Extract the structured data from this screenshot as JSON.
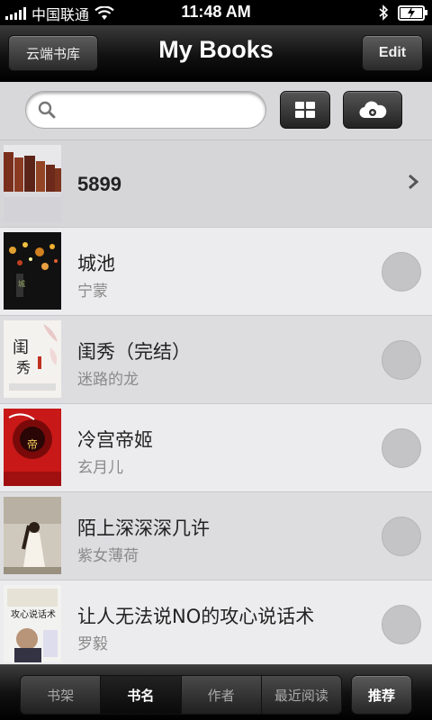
{
  "status_bar": {
    "carrier": "中国联通",
    "time": "11:48 AM"
  },
  "nav": {
    "left_button": "云端书库",
    "title": "My Books",
    "right_button": "Edit"
  },
  "search": {
    "placeholder": ""
  },
  "books": [
    {
      "title": "5899",
      "author": ""
    },
    {
      "title": "城池",
      "author": "宁蒙"
    },
    {
      "title": "闺秀（完结）",
      "author": "迷路的龙"
    },
    {
      "title": "冷宫帝姬",
      "author": "玄月儿"
    },
    {
      "title": "陌上深深深几许",
      "author": "紫女薄荷"
    },
    {
      "title": "让人无法说NO的攻心说话术",
      "author": "罗毅"
    }
  ],
  "tabs": {
    "items": [
      "书架",
      "书名",
      "作者",
      "最近阅读"
    ],
    "active": "书名",
    "recommend": "推荐"
  }
}
